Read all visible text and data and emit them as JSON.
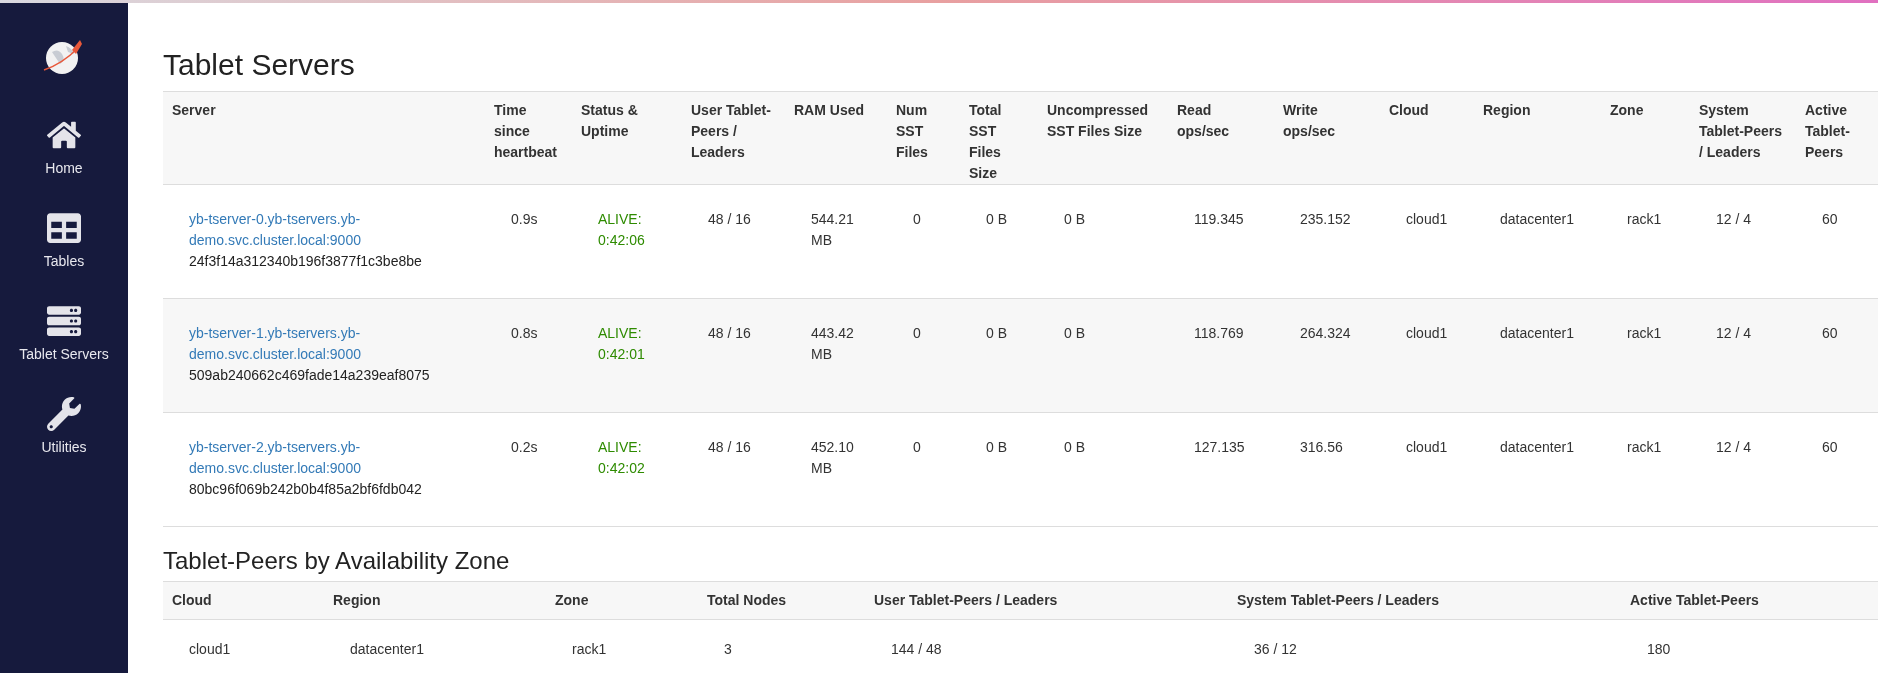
{
  "sidebar": {
    "items": [
      {
        "label": "Home",
        "kind": "home"
      },
      {
        "label": "Tables",
        "kind": "table"
      },
      {
        "label": "Tablet Servers",
        "kind": "server"
      },
      {
        "label": "Utilities",
        "kind": "wrench"
      }
    ]
  },
  "title": "Tablet Servers",
  "servers_table": {
    "columns": [
      "Server",
      "Time since heartbeat",
      "Status & Uptime",
      "User Tablet-Peers / Leaders",
      "RAM Used",
      "Num SST Files",
      "Total SST Files Size",
      "Uncompressed SST Files Size",
      "Read ops/sec",
      "Write ops/sec",
      "Cloud",
      "Region",
      "Zone",
      "System Tablet-Peers / Leaders",
      "Active Tablet-Peers"
    ],
    "rows": [
      {
        "server": "yb-tserver-0.yb-tservers.yb-demo.svc.cluster.local:9000",
        "uuid": "24f3f14a312340b196f3877f1c3be8be",
        "heartbeat": "0.9s",
        "status": "ALIVE: 0:42:06",
        "alive": true,
        "user_peers": "48 / 16",
        "ram": "544.21 MB",
        "num_sst": "0",
        "total_sst": "0 B",
        "uncompressed_sst": "0 B",
        "read_ops": "119.345",
        "write_ops": "235.152",
        "cloud": "cloud1",
        "region": "datacenter1",
        "zone": "rack1",
        "system_peers": "12 / 4",
        "active_peers": "60"
      },
      {
        "server": "yb-tserver-1.yb-tservers.yb-demo.svc.cluster.local:9000",
        "uuid": "509ab240662c469fade14a239eaf8075",
        "heartbeat": "0.8s",
        "status": "ALIVE: 0:42:01",
        "alive": true,
        "user_peers": "48 / 16",
        "ram": "443.42 MB",
        "num_sst": "0",
        "total_sst": "0 B",
        "uncompressed_sst": "0 B",
        "read_ops": "118.769",
        "write_ops": "264.324",
        "cloud": "cloud1",
        "region": "datacenter1",
        "zone": "rack1",
        "system_peers": "12 / 4",
        "active_peers": "60"
      },
      {
        "server": "yb-tserver-2.yb-tservers.yb-demo.svc.cluster.local:9000",
        "uuid": "80bc96f069b242b0b4f85a2bf6fdb042",
        "heartbeat": "0.2s",
        "status": "ALIVE: 0:42:02",
        "alive": true,
        "user_peers": "48 / 16",
        "ram": "452.10 MB",
        "num_sst": "0",
        "total_sst": "0 B",
        "uncompressed_sst": "0 B",
        "read_ops": "127.135",
        "write_ops": "316.56",
        "cloud": "cloud1",
        "region": "datacenter1",
        "zone": "rack1",
        "system_peers": "12 / 4",
        "active_peers": "60"
      }
    ]
  },
  "zone_title": "Tablet-Peers by Availability Zone",
  "zone_table": {
    "columns": [
      "Cloud",
      "Region",
      "Zone",
      "Total Nodes",
      "User Tablet-Peers / Leaders",
      "System Tablet-Peers / Leaders",
      "Active Tablet-Peers"
    ],
    "rows": [
      [
        "cloud1",
        "datacenter1",
        "rack1",
        "3",
        "144 / 48",
        "36 / 12",
        "180"
      ]
    ]
  }
}
